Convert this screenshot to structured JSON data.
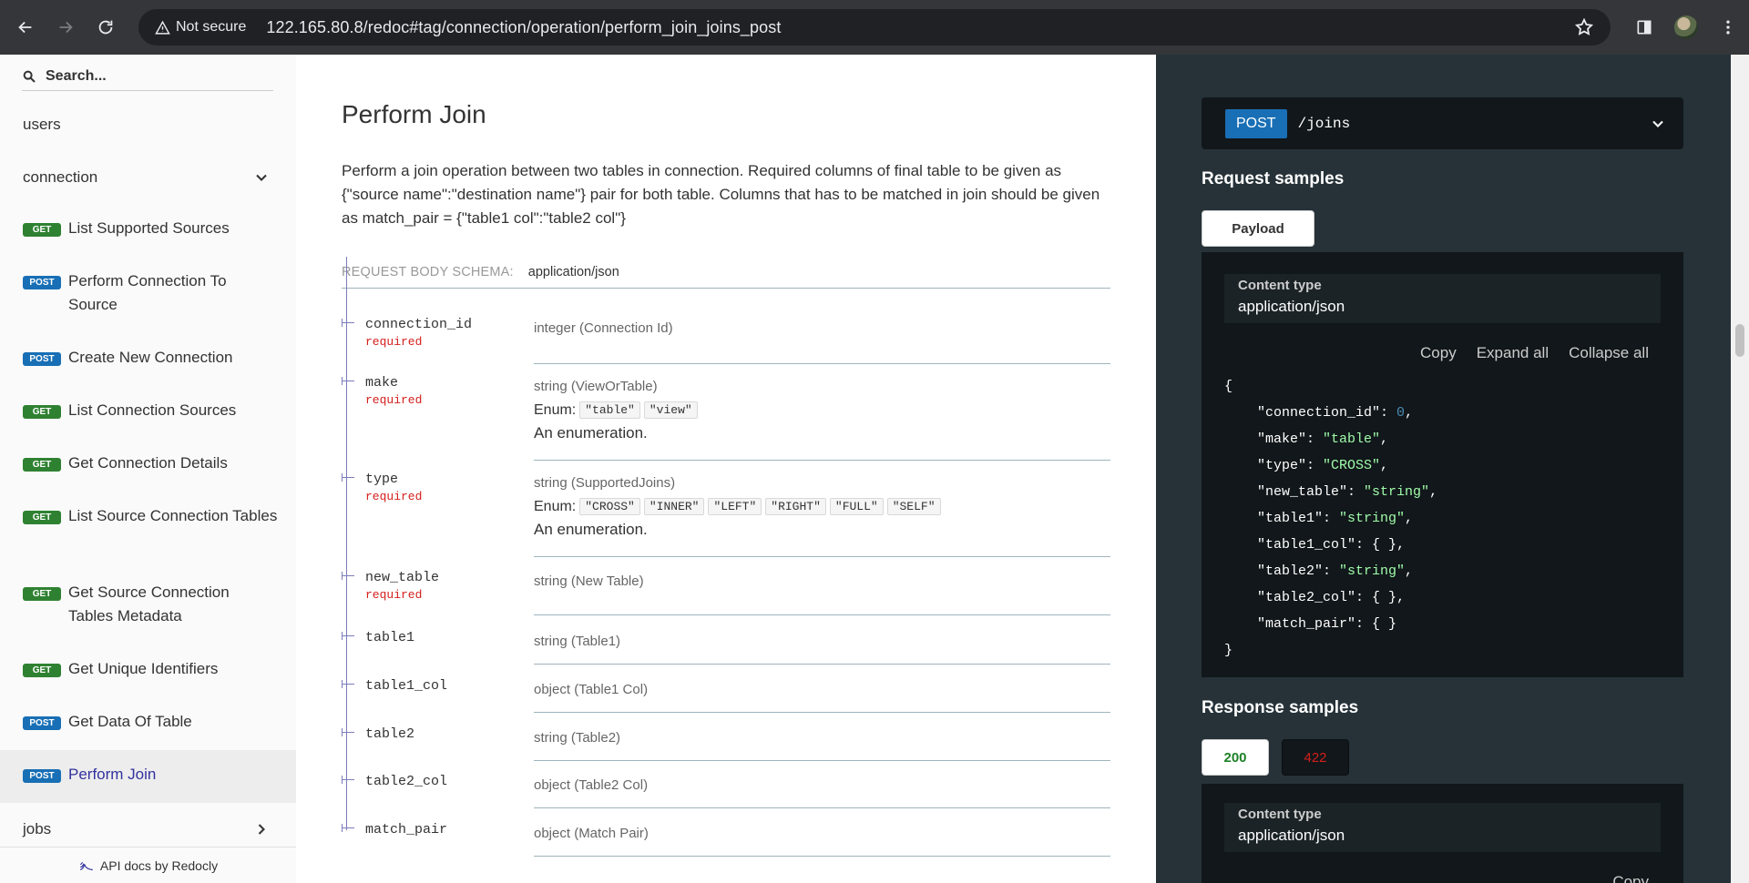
{
  "browser": {
    "security_label": "Not secure",
    "url": "122.165.80.8/redoc#tag/connection/operation/perform_join_joins_post"
  },
  "sidebar": {
    "search_placeholder": "Search...",
    "groups": {
      "users": "users",
      "connection": "connection",
      "jobs": "jobs"
    },
    "operations": [
      {
        "method": "GET",
        "label": "List Supported Sources"
      },
      {
        "method": "POST",
        "label": "Perform Connection To Source"
      },
      {
        "method": "POST",
        "label": "Create New Connection"
      },
      {
        "method": "GET",
        "label": "List Connection Sources"
      },
      {
        "method": "GET",
        "label": "Get Connection Details"
      },
      {
        "method": "GET",
        "label": "List Source Connection Tables"
      },
      {
        "method": "GET",
        "label": "Get Source Connection Tables Metadata"
      },
      {
        "method": "GET",
        "label": "Get Unique Identifiers"
      },
      {
        "method": "POST",
        "label": "Get Data Of Table"
      },
      {
        "method": "POST",
        "label": "Perform Join"
      }
    ],
    "footer": "API docs by Redocly"
  },
  "main": {
    "title": "Perform Join",
    "description": "Perform a join operation between two tables in connection. Required columns of final table to be given as {\"source name\":\"destination name\"} pair for both table. Columns that has to be matched in join should be given as match_pair = {\"table1 col\":\"table2 col\"}",
    "schema_label": "REQUEST BODY SCHEMA:",
    "schema_type": "application/json",
    "enum_label": "Enum:",
    "required_label": "required",
    "properties": [
      {
        "name": "connection_id",
        "type": "integer (Connection Id)"
      },
      {
        "name": "make",
        "type": "string (ViewOrTable)",
        "enum": [
          "\"table\"",
          "\"view\""
        ],
        "note": "An enumeration."
      },
      {
        "name": "type",
        "type": "string (SupportedJoins)",
        "enum": [
          "\"CROSS\"",
          "\"INNER\"",
          "\"LEFT\"",
          "\"RIGHT\"",
          "\"FULL\"",
          "\"SELF\""
        ],
        "note": "An enumeration."
      },
      {
        "name": "new_table",
        "type": "string (New Table)"
      },
      {
        "name": "table1",
        "type": "string (Table1)"
      },
      {
        "name": "table1_col",
        "type": "object (Table1 Col)"
      },
      {
        "name": "table2",
        "type": "string (Table2)"
      },
      {
        "name": "table2_col",
        "type": "object (Table2 Col)"
      },
      {
        "name": "match_pair",
        "type": "object (Match Pair)"
      }
    ]
  },
  "right": {
    "method": "POST",
    "path": "/joins",
    "request_title": "Request samples",
    "payload_tab": "Payload",
    "content_type_label": "Content type",
    "content_type": "application/json",
    "actions": {
      "copy": "Copy",
      "expand": "Expand all",
      "collapse": "Collapse all"
    },
    "json_open": "{",
    "json_close": "}",
    "json_lines": [
      {
        "key": "\"connection_id\"",
        "value": "0",
        "kind": "n"
      },
      {
        "key": "\"make\"",
        "value": "\"table\"",
        "kind": "s"
      },
      {
        "key": "\"type\"",
        "value": "\"CROSS\"",
        "kind": "s"
      },
      {
        "key": "\"new_table\"",
        "value": "\"string\"",
        "kind": "s"
      },
      {
        "key": "\"table1\"",
        "value": "\"string\"",
        "kind": "s"
      },
      {
        "key": "\"table1_col\"",
        "value": "{ }",
        "kind": "o"
      },
      {
        "key": "\"table2\"",
        "value": "\"string\"",
        "kind": "s"
      },
      {
        "key": "\"table2_col\"",
        "value": "{ }",
        "kind": "o"
      },
      {
        "key": "\"match_pair\"",
        "value": "{ }",
        "kind": "o"
      }
    ],
    "response_title": "Response samples",
    "response_tabs": [
      "200",
      "422"
    ],
    "response_copy": "Copy"
  },
  "colors": {
    "get": "#2f8132",
    "post": "#186fb5",
    "right_panel": "#263238",
    "status_200": "#1d8127",
    "status_422": "#d41f1c"
  }
}
